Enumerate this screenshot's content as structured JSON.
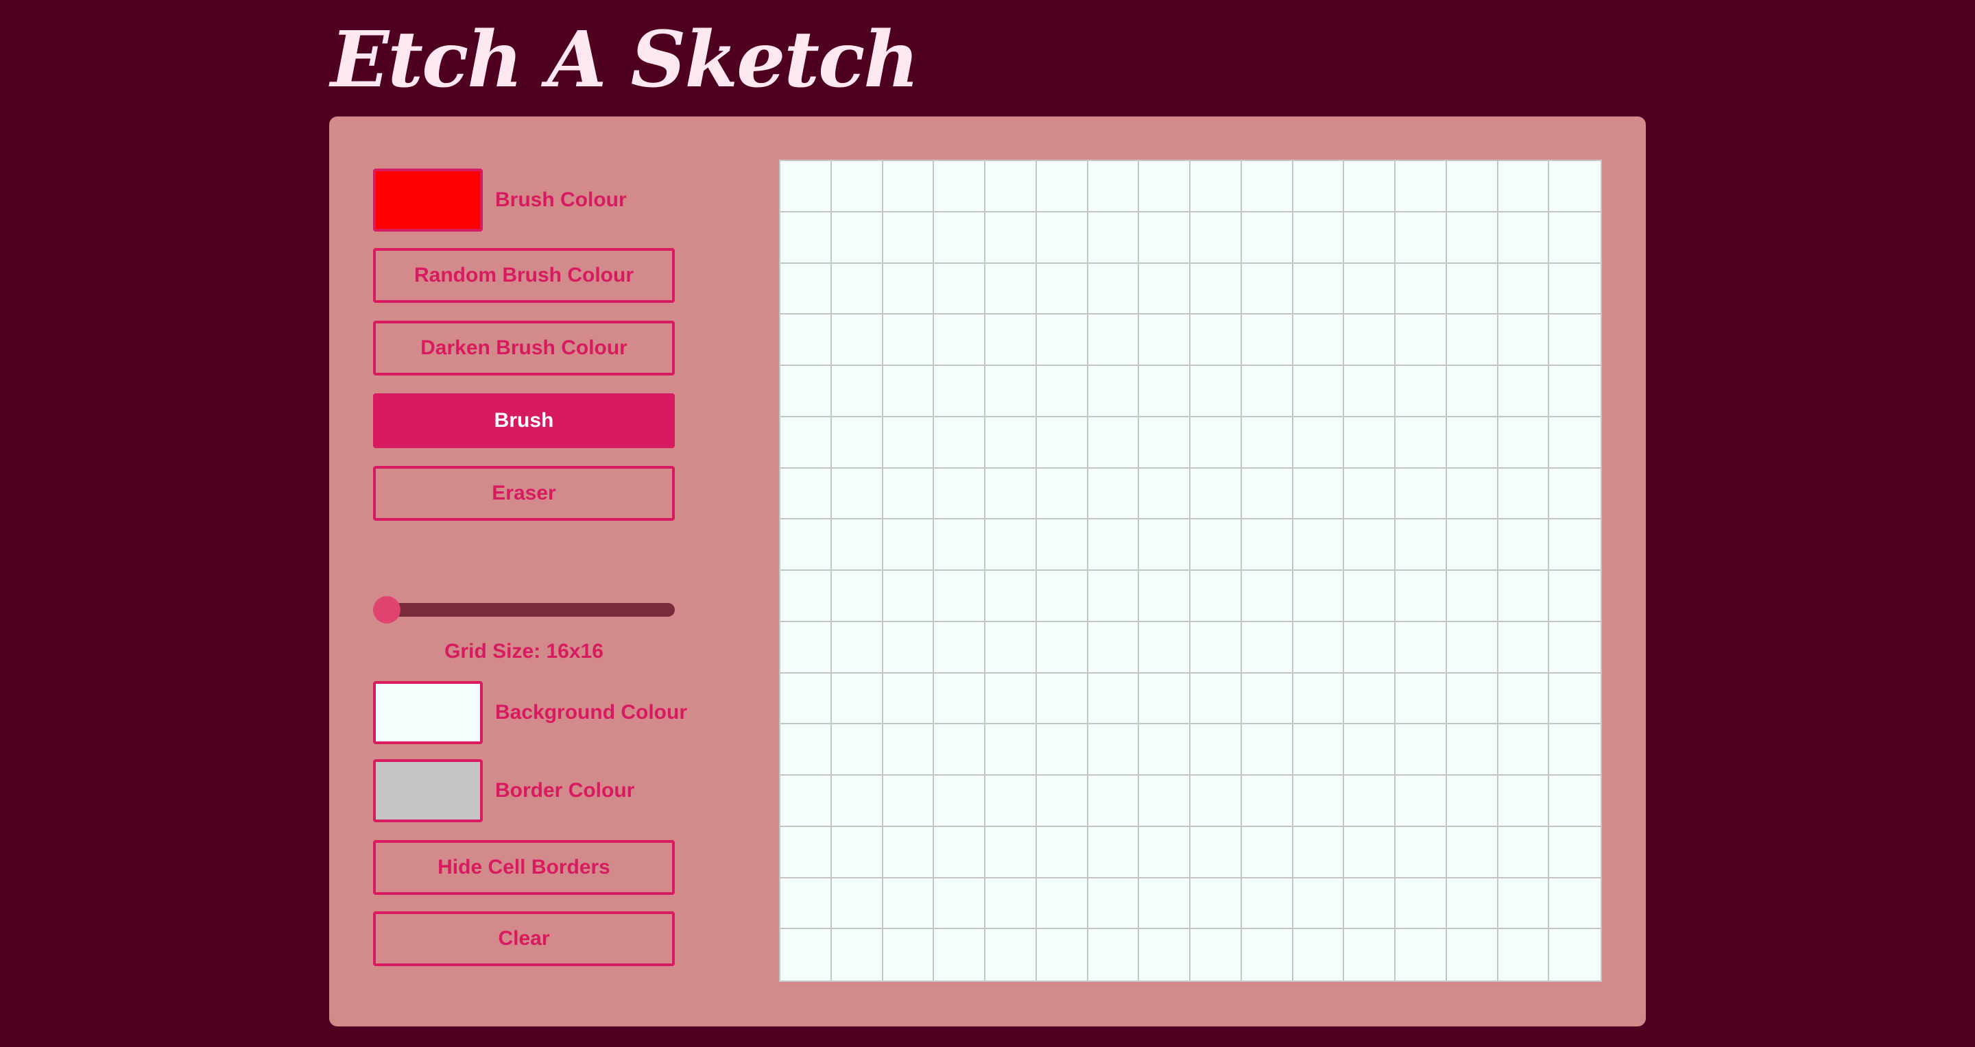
{
  "app": {
    "title": "Etch A Sketch"
  },
  "controls": {
    "brush_colour": {
      "label": "Brush Colour",
      "value": "#ff0000"
    },
    "random_brush_colour_label": "Random Brush Colour",
    "darken_brush_colour_label": "Darken Brush Colour",
    "brush_label": "Brush",
    "eraser_label": "Eraser",
    "active_tool": "brush",
    "grid_size": {
      "min": 16,
      "value": 16,
      "text": "Grid Size: 16x16"
    },
    "background_colour": {
      "label": "Background Colour",
      "value": "#f4fffd"
    },
    "border_colour": {
      "label": "Border Colour",
      "value": "#c4c4c4"
    },
    "hide_cell_borders_label": "Hide Cell Borders",
    "clear_label": "Clear"
  },
  "grid": {
    "columns": 16,
    "rows": 16
  },
  "colors": {
    "page_background": "#4f0020",
    "panel_background": "#d38a8a",
    "accent": "#d81b60",
    "title_text": "#fde8ef",
    "slider_track": "#7a2a3d",
    "slider_thumb": "#e0436f"
  }
}
